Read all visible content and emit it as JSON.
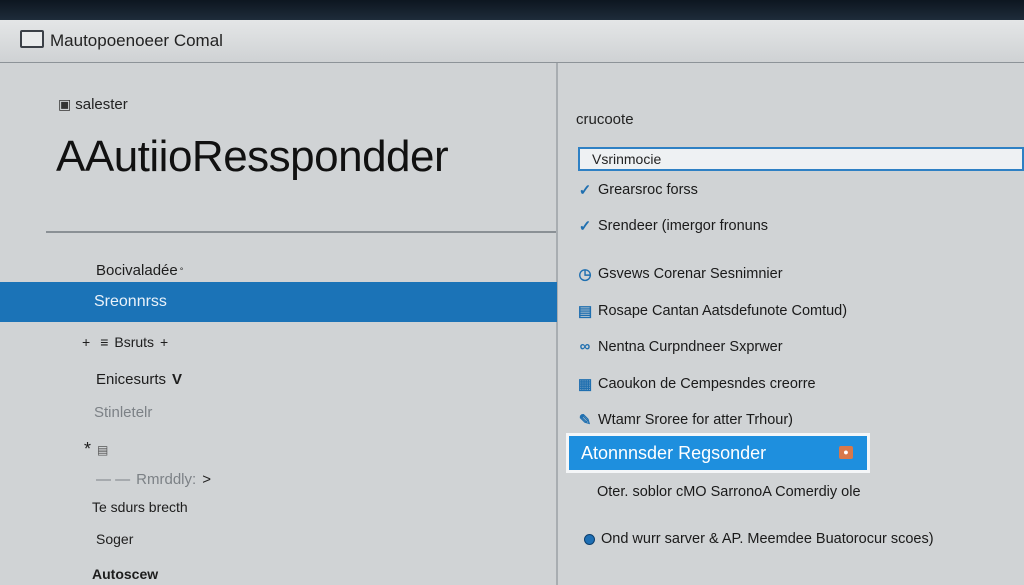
{
  "window": {
    "title": "Mautopoenoeer Comal"
  },
  "left": {
    "breadcrumb": "salester",
    "page_title": "AAutiioResspondder",
    "nav": [
      {
        "label": "Bocivaladée"
      },
      {
        "label": "Sreonnrss",
        "selected": true
      },
      {
        "label": "Bsruts",
        "prefix": "+",
        "suffix": "+"
      },
      {
        "label": "Enicesurts"
      },
      {
        "label": "Stinletelr"
      },
      {
        "label": "*"
      },
      {
        "label": "Rmrddly:"
      },
      {
        "label": "Te sdurs brecth"
      },
      {
        "label": "Soger"
      },
      {
        "label": "Autoscew"
      }
    ]
  },
  "right": {
    "section_label": "crucoote",
    "search": {
      "value": "Vsrinmocie"
    },
    "rules": [
      {
        "icon": "check-icon",
        "label": "Grearsroc forss"
      },
      {
        "icon": "check-icon",
        "label": "Srendeer (imergor fronuns"
      },
      {
        "icon": "clock-icon",
        "label": "Gsvews Corenar Sesnimnier"
      },
      {
        "icon": "document-icon",
        "label": "Rosape Cantan Aatsdefunote Comtud)"
      },
      {
        "icon": "link-icon",
        "label": "Nentna Curpndneer Sxprwer"
      },
      {
        "icon": "calendar-icon",
        "label": "Caoukon de Cempesndes creorre"
      },
      {
        "icon": "pencil-icon",
        "label": "Wtamr Sroree for atter Trhour)"
      }
    ],
    "highlight": {
      "label": "Atonnnsder Regsonder"
    },
    "description": "Oter. soblor cMO SarronoA Comerdiy ole",
    "status": {
      "label": "Ond wurr sarver & AP. Meemdee Buatorocur scoes)"
    }
  }
}
